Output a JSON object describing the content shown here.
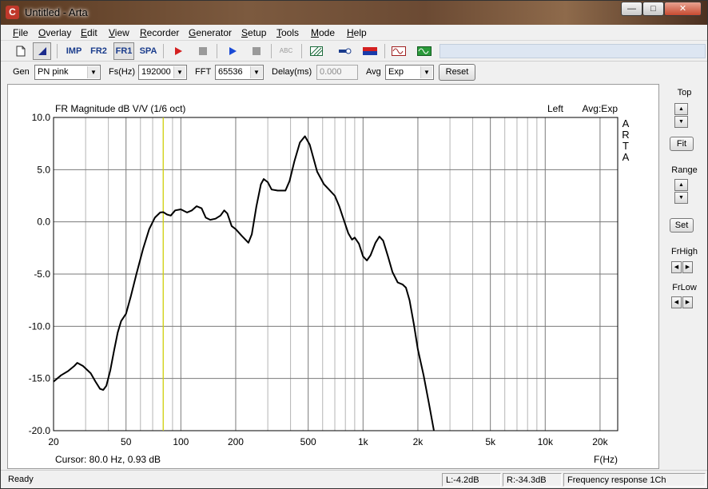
{
  "window": {
    "title": "Untitled - Arta",
    "app_icon": "C"
  },
  "titlebar_buttons": {
    "minimize": "—",
    "maximize": "□",
    "close": "✕"
  },
  "menu": [
    {
      "label": "File",
      "x": 15
    },
    {
      "label": "Overlay",
      "x": 47
    },
    {
      "label": "Edit",
      "x": 100
    },
    {
      "label": "View",
      "x": 135
    },
    {
      "label": "Recorder",
      "x": 174
    },
    {
      "label": "Generator",
      "x": 235
    },
    {
      "label": "Setup",
      "x": 301
    },
    {
      "label": "Tools",
      "x": 345
    },
    {
      "label": "Mode",
      "x": 388
    },
    {
      "label": "Help",
      "x": 433
    }
  ],
  "toolbar": {
    "imp": "IMP",
    "fr2": "FR2",
    "fr1": "FR1",
    "spa": "SPA",
    "abc": "ABC"
  },
  "settings": {
    "gen_label": "Gen",
    "gen_value": "PN pink",
    "fs_label": "Fs(Hz)",
    "fs_value": "192000",
    "fft_label": "FFT",
    "fft_value": "65536",
    "delay_label": "Delay(ms)",
    "delay_value": "0.000",
    "avg_label": "Avg",
    "avg_value": "Exp",
    "reset_label": "Reset"
  },
  "chart_data": {
    "type": "line",
    "title": "FR Magnitude dB V/V (1/6 oct)",
    "channel_label": "Left",
    "avg_label": "Avg:Exp",
    "watermark": [
      "A",
      "R",
      "T",
      "A"
    ],
    "xlabel": "F(Hz)",
    "xscale": "log",
    "xlim": [
      20,
      25000
    ],
    "ylim": [
      -20,
      10
    ],
    "y_ticks": [
      10.0,
      5.0,
      0.0,
      -5.0,
      -10.0,
      -15.0,
      -20.0
    ],
    "y_tick_labels": [
      "10.0",
      "5.0",
      "0.0",
      "-5.0",
      "-10.0",
      "-15.0",
      "-20.0"
    ],
    "x_ticks": [
      20,
      50,
      100,
      200,
      500,
      1000,
      2000,
      5000,
      10000,
      20000
    ],
    "x_tick_labels": [
      "20",
      "50",
      "100",
      "200",
      "500",
      "1k",
      "2k",
      "5k",
      "10k",
      "20k"
    ],
    "grid": true,
    "cursor_freq_hz": 80.0,
    "cursor_text": "Cursor:   80.0 Hz, 0.93 dB",
    "series": [
      {
        "name": "Left",
        "color": "#000000",
        "points": [
          [
            20,
            -15.3
          ],
          [
            22,
            -14.7
          ],
          [
            24,
            -14.3
          ],
          [
            26,
            -13.8
          ],
          [
            27,
            -13.5
          ],
          [
            29,
            -13.8
          ],
          [
            32,
            -14.5
          ],
          [
            34,
            -15.3
          ],
          [
            36,
            -16.0
          ],
          [
            37.5,
            -16.1
          ],
          [
            39,
            -15.7
          ],
          [
            41,
            -14.2
          ],
          [
            43,
            -12.3
          ],
          [
            45,
            -10.6
          ],
          [
            47,
            -9.5
          ],
          [
            50,
            -8.8
          ],
          [
            53,
            -7.2
          ],
          [
            57,
            -5.0
          ],
          [
            62,
            -2.6
          ],
          [
            67,
            -0.7
          ],
          [
            72,
            0.4
          ],
          [
            77,
            0.9
          ],
          [
            80,
            0.93
          ],
          [
            84,
            0.7
          ],
          [
            88,
            0.6
          ],
          [
            93,
            1.1
          ],
          [
            100,
            1.2
          ],
          [
            108,
            0.9
          ],
          [
            115,
            1.1
          ],
          [
            122,
            1.5
          ],
          [
            130,
            1.3
          ],
          [
            137,
            0.4
          ],
          [
            145,
            0.2
          ],
          [
            155,
            0.3
          ],
          [
            165,
            0.6
          ],
          [
            173,
            1.1
          ],
          [
            180,
            0.8
          ],
          [
            190,
            -0.4
          ],
          [
            200,
            -0.7
          ],
          [
            215,
            -1.3
          ],
          [
            235,
            -2.0
          ],
          [
            245,
            -1.2
          ],
          [
            260,
            1.5
          ],
          [
            275,
            3.6
          ],
          [
            285,
            4.1
          ],
          [
            300,
            3.8
          ],
          [
            315,
            3.1
          ],
          [
            340,
            3.0
          ],
          [
            375,
            3.0
          ],
          [
            395,
            3.9
          ],
          [
            420,
            5.8
          ],
          [
            450,
            7.6
          ],
          [
            480,
            8.2
          ],
          [
            510,
            7.4
          ],
          [
            560,
            4.8
          ],
          [
            610,
            3.6
          ],
          [
            650,
            3.1
          ],
          [
            700,
            2.5
          ],
          [
            740,
            1.5
          ],
          [
            780,
            0.3
          ],
          [
            830,
            -1.1
          ],
          [
            870,
            -1.7
          ],
          [
            900,
            -1.5
          ],
          [
            950,
            -2.1
          ],
          [
            1000,
            -3.3
          ],
          [
            1050,
            -3.7
          ],
          [
            1100,
            -3.2
          ],
          [
            1170,
            -2.0
          ],
          [
            1230,
            -1.4
          ],
          [
            1290,
            -1.8
          ],
          [
            1370,
            -3.3
          ],
          [
            1450,
            -4.8
          ],
          [
            1550,
            -5.8
          ],
          [
            1650,
            -6.0
          ],
          [
            1720,
            -6.3
          ],
          [
            1800,
            -7.5
          ],
          [
            1900,
            -9.8
          ],
          [
            2000,
            -12.2
          ],
          [
            2150,
            -14.7
          ],
          [
            2300,
            -17.4
          ],
          [
            2450,
            -20.0
          ]
        ]
      }
    ]
  },
  "controls": {
    "top_label": "Top",
    "fit_label": "Fit",
    "range_label": "Range",
    "set_label": "Set",
    "frhigh_label": "FrHigh",
    "frlow_label": "FrLow"
  },
  "status": {
    "ready": "Ready",
    "left_level": "L:-4.2dB",
    "right_level": "R:-34.3dB",
    "mode": "Frequency response 1Ch"
  },
  "colors": {
    "plot_line": "#000000",
    "grid": "#b4b4b4",
    "grid_bold": "#7a7a7a",
    "cursor": "#d4d400",
    "record": "#d42020",
    "play": "#1a4ad6"
  }
}
